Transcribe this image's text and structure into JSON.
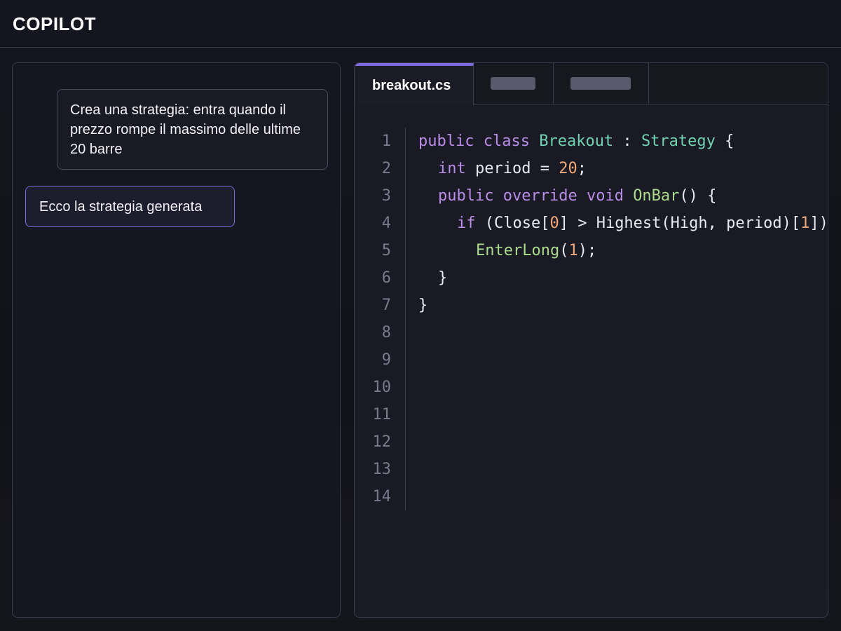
{
  "app": {
    "title": "COPILOT"
  },
  "chat": {
    "messages": [
      {
        "role": "user",
        "text": "Crea una strategia: entra quando il prezzo rompe il massimo delle ultime 20 barre"
      },
      {
        "role": "assistant",
        "text": "Ecco la strategia generata"
      }
    ]
  },
  "editor": {
    "tabs": [
      {
        "label": "breakout.cs",
        "active": true
      },
      {
        "label": "",
        "active": false
      },
      {
        "label": "",
        "active": false
      }
    ],
    "line_numbers": [
      "1",
      "2",
      "3",
      "4",
      "5",
      "6",
      "7",
      "8",
      "9",
      "10",
      "11",
      "12",
      "13",
      "14"
    ],
    "code": {
      "l1": {
        "kw1": "public",
        "kw2": "class",
        "name": "Breakout",
        "sep": " : ",
        "base": "Strategy",
        "brace": " {"
      },
      "l2": {
        "kw": "int",
        "rest": " period = ",
        "num": "20",
        "end": ";"
      },
      "l3": {
        "kw1": "public",
        "kw2": "override",
        "kw3": "void",
        "fn": "OnBar",
        "end": "() {"
      },
      "l4": {
        "kw": "if",
        "p1": " (Close[",
        "n1": "0",
        "p2": "] > Highest(High, period)[",
        "n2": "1",
        "p3": "])"
      },
      "l5": {
        "fn": "EnterLong",
        "p1": "(",
        "num": "1",
        "p2": ");"
      },
      "l6": {
        "text": "}"
      },
      "l7": {
        "text": "}"
      }
    }
  },
  "colors": {
    "accent": "#7e6be0",
    "keyword": "#b88de8",
    "type": "#6fd3b0",
    "function": "#a9db8a",
    "number": "#f0a878"
  }
}
